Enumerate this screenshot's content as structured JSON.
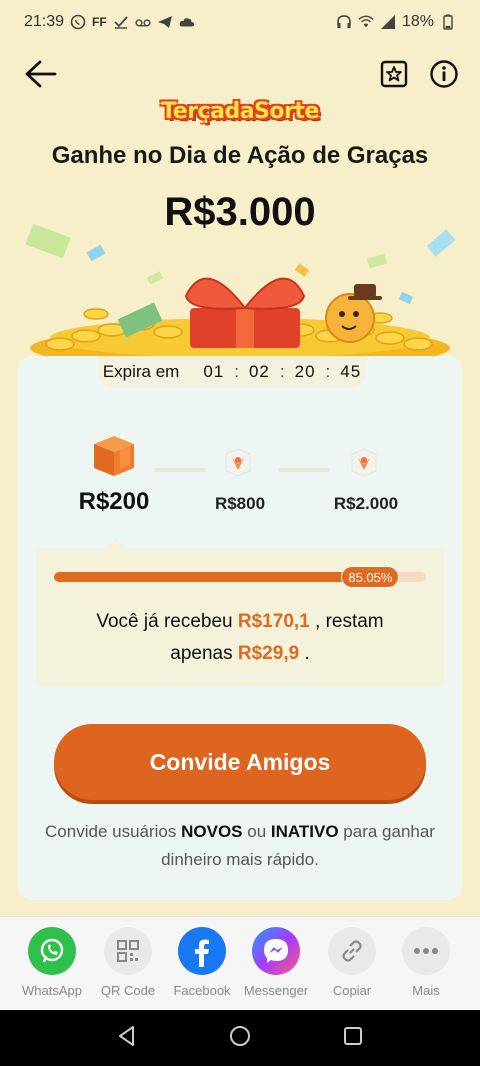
{
  "status_bar": {
    "time": "21:39",
    "battery": "18%",
    "left_icons": [
      "whatsapp-icon",
      "ff-icon",
      "check-icon",
      "voicemail-icon",
      "telegram-icon",
      "cloud-icon"
    ],
    "ff_text": "FF"
  },
  "header": {
    "logo_text": "TerçadaSorte",
    "title": "Ganhe no Dia de Ação de Graças",
    "amount": "R$3.000"
  },
  "timer": {
    "label": "Expira em",
    "hours": "01",
    "minutes": "02",
    "seconds": "20",
    "frames": "45",
    "separator": ":"
  },
  "milestones": [
    {
      "label": "R$200",
      "state": "active"
    },
    {
      "label": "R$800",
      "state": "locked"
    },
    {
      "label": "R$2.000",
      "state": "locked"
    }
  ],
  "progress": {
    "fraction": 0.8505,
    "percent_label": "85.05%",
    "line1_prefix": "Você já recebeu ",
    "received": "R$170,1",
    "line1_suffix": " , restam",
    "line2_prefix": "apenas ",
    "remaining": "R$29,9",
    "line2_suffix": " ."
  },
  "cta": {
    "label": "Convide Amigos"
  },
  "subtext": {
    "part1": "Convide usuários ",
    "bold1": "NOVOS",
    "part2": " ou ",
    "bold2": "INATIVO",
    "part3": " para ganhar dinheiro mais rápido."
  },
  "share": [
    {
      "label": "WhatsApp",
      "icon": "whatsapp-icon",
      "color": "#2fbf4b"
    },
    {
      "label": "QR Code",
      "icon": "qr-code-icon",
      "color": "#e6e6e6"
    },
    {
      "label": "Facebook",
      "icon": "facebook-icon",
      "color": "#1877f2"
    },
    {
      "label": "Messenger",
      "icon": "messenger-icon",
      "color": "#7b5cff"
    },
    {
      "label": "Copiar",
      "icon": "link-icon",
      "color": "#e6e6e6"
    },
    {
      "label": "Mais",
      "icon": "more-icon",
      "color": "#e6e6e6"
    }
  ],
  "colors": {
    "accent": "#de6520",
    "background": "#f6efc9",
    "panel": "#eef6f4"
  }
}
